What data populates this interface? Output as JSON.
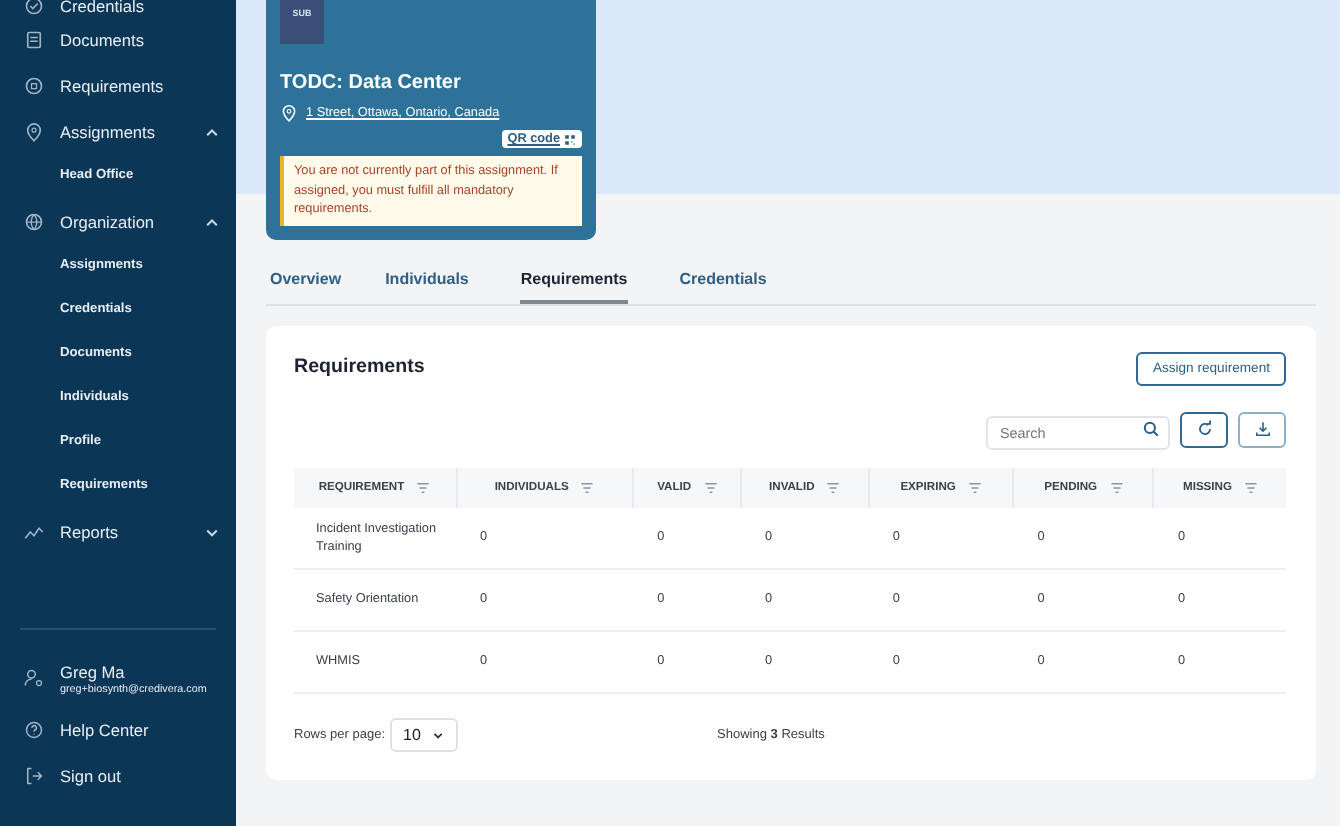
{
  "sidebar": {
    "items": [
      {
        "label": "Credentials"
      },
      {
        "label": "Documents"
      },
      {
        "label": "Requirements"
      },
      {
        "label": "Assignments",
        "expanded": true,
        "children": [
          {
            "label": "Head Office"
          }
        ]
      },
      {
        "label": "Organization",
        "expanded": true,
        "children": [
          {
            "label": "Assignments"
          },
          {
            "label": "Credentials"
          },
          {
            "label": "Documents"
          },
          {
            "label": "Individuals"
          },
          {
            "label": "Profile"
          },
          {
            "label": "Requirements"
          }
        ]
      },
      {
        "label": "Reports",
        "expanded": false
      }
    ],
    "user": {
      "name": "Greg Ma",
      "email": "greg+biosynth@credivera.com"
    },
    "footer": [
      {
        "label": "Help Center"
      },
      {
        "label": "Sign out"
      }
    ]
  },
  "assignment": {
    "logo": "SUB",
    "title": "TODC: Data Center",
    "address": "1 Street, Ottawa, Ontario, Canada",
    "qr_link": "QR code",
    "notice": "You are not currently part of this assignment. If assigned, you must fulfill all mandatory requirements."
  },
  "tabs": [
    {
      "label": "Overview",
      "selected": false
    },
    {
      "label": "Individuals",
      "selected": false
    },
    {
      "label": "Requirements",
      "selected": true
    },
    {
      "label": "Credentials",
      "selected": false
    }
  ],
  "panel": {
    "title": "Requirements",
    "assign_button": "Assign requirement",
    "search": {
      "placeholder": "Search"
    },
    "table": {
      "columns": [
        "REQUIREMENT",
        "INDIVIDUALS",
        "VALID",
        "INVALID",
        "EXPIRING",
        "PENDING",
        "MISSING"
      ],
      "rows": [
        [
          "Incident Investigation Training",
          "0",
          "0",
          "0",
          "0",
          "0",
          "0"
        ],
        [
          "Safety Orientation",
          "0",
          "0",
          "0",
          "0",
          "0",
          "0"
        ],
        [
          "WHMIS",
          "0",
          "0",
          "0",
          "0",
          "0",
          "0"
        ]
      ]
    },
    "rows_per_page_label": "Rows per page:",
    "rows_per_page": "10",
    "summary": "Showing **3** Results"
  }
}
